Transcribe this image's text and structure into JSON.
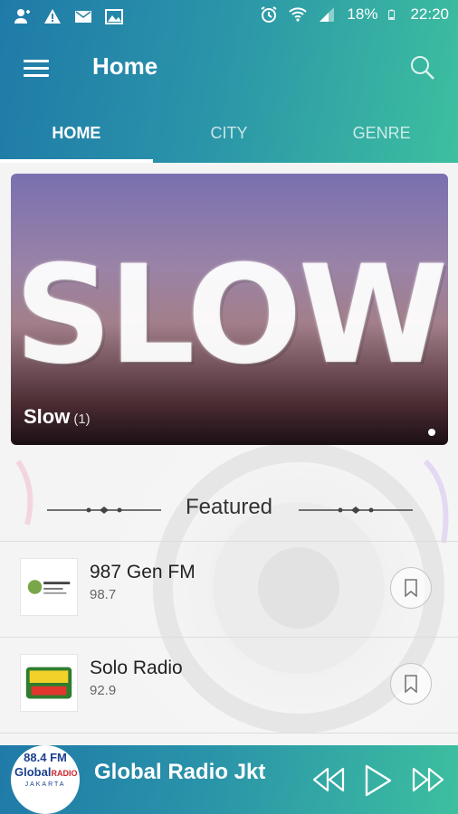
{
  "status": {
    "battery": "18%",
    "time": "22:20"
  },
  "appbar": {
    "title": "Home"
  },
  "tabs": [
    {
      "label": "HOME"
    },
    {
      "label": "CITY"
    },
    {
      "label": "GENRE"
    }
  ],
  "banner": {
    "image_text": "SLOW",
    "label": "Slow",
    "count": "(1)"
  },
  "featured": {
    "heading": "Featured"
  },
  "stations": [
    {
      "name": "987 Gen FM",
      "freq": "98.7",
      "logo": "gen-fm-logo"
    },
    {
      "name": "Solo Radio",
      "freq": "92.9",
      "logo": "solo-radio-logo"
    }
  ],
  "player": {
    "name": "Global Radio Jkt",
    "logo_top": "88.4 FM",
    "logo_mid": "Global",
    "logo_brand": "RADIO",
    "logo_city": "JAKARTA"
  },
  "colors": {
    "accent_start": "#1f7aa8",
    "accent_end": "#3dbf9f"
  }
}
